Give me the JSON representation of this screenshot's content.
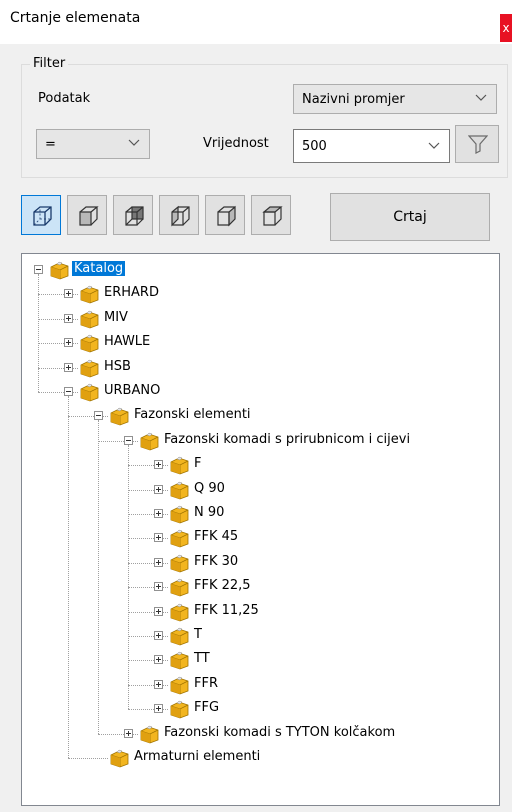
{
  "window": {
    "title": "Crtanje elemenata",
    "close_label": "x"
  },
  "filter": {
    "group_label": "Filter",
    "podatak_label": "Podatak",
    "field_selected": "Nazivni promjer",
    "operator_selected": "=",
    "vrijednost_label": "Vrijednost",
    "value_selected": "500"
  },
  "toolbar": {
    "view_buttons": [
      "view-iso",
      "view-front",
      "view-back",
      "view-left",
      "view-right",
      "view-top"
    ],
    "draw_label": "Crtaj"
  },
  "tree": {
    "root": "Katalog",
    "manufacturers": [
      "ERHARD",
      "MIV",
      "HAWLE",
      "HSB",
      "URBANO"
    ],
    "urbano_children": [
      "Fazonski elementi",
      "Armaturni elementi"
    ],
    "fazonski_children": [
      "Fazonski komadi s prirubnicom i cijevi",
      "Fazonski komadi s TYTON kolčakom"
    ],
    "prirubnica_children": [
      "F",
      "Q 90",
      "N 90",
      "FFK 45",
      "FFK 30",
      "FFK 22,5",
      "FFK 11,25",
      "T",
      "TT",
      "FFR",
      "FFG"
    ]
  }
}
